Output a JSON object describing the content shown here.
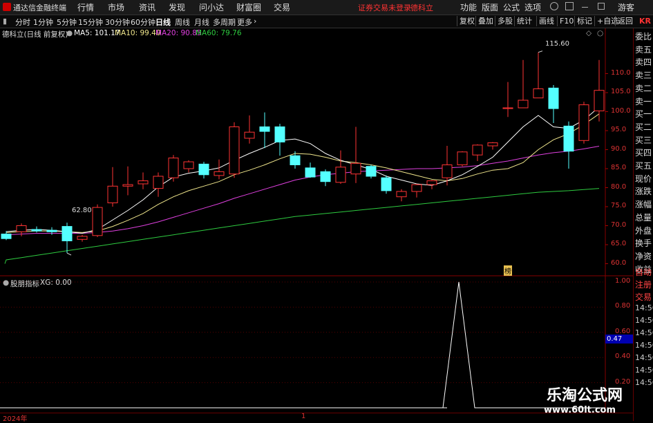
{
  "app": {
    "title": "通达信金融终端"
  },
  "menu": [
    "行情",
    "市场",
    "资讯",
    "发现",
    "问小达",
    "财富圈",
    "交易"
  ],
  "top_notice": {
    "warn": "证券交易未登录",
    "stock": "德科立"
  },
  "top_right": [
    "功能",
    "版面",
    "公式",
    "选项",
    "游客"
  ],
  "periods": [
    "分时",
    "1分钟",
    "5分钟",
    "15分钟",
    "30分钟",
    "60分钟",
    "日线",
    "周线",
    "月线",
    "多周期",
    "更多"
  ],
  "active_period": "日线",
  "tools": [
    "复权",
    "叠加",
    "多股",
    "统计",
    "画线",
    "F10",
    "标记",
    "+自选",
    "返回"
  ],
  "kr_label": "KR",
  "main_info": {
    "name": "德科立(日线 前复权)",
    "ma5": "MA5: 101.17",
    "ma10": "MA10: 99.40",
    "ma20": "MA20: 90.85",
    "ma60": "MA60: 79.76"
  },
  "colors": {
    "ma5": "#ffffff",
    "ma10": "#f0e68c",
    "ma20": "#e040e0",
    "ma60": "#2ecc40",
    "up": "#ff3333",
    "down": "#54ffff"
  },
  "annotations": {
    "high": "115.60",
    "low": "62.80",
    "mark": "榜"
  },
  "price_axis": [
    "110.0",
    "105.0",
    "100.0",
    "95.0",
    "90.0",
    "85.0",
    "80.0",
    "75.0",
    "70.0",
    "65.0",
    "60.0"
  ],
  "right_quote_labels": [
    "委比",
    "卖五",
    "卖四",
    "卖三",
    "卖二",
    "卖一",
    "买一",
    "买二",
    "买三",
    "买四",
    "买五",
    "现价",
    "涨跌",
    "涨幅",
    "总量",
    "外盘",
    "换手",
    "净资",
    "收益"
  ],
  "indicator": {
    "name": "股朋指标",
    "value": "XG: 0.00",
    "axis": [
      "1.00",
      "0.80",
      "0.60",
      "0.40",
      "0.20"
    ],
    "cursor_value": "0.47"
  },
  "right_lower_labels": [
    "自动",
    "注册",
    "交易",
    "14:56",
    "14:56",
    "14:56",
    "14:56",
    "14:56",
    "14:56",
    "14:56"
  ],
  "bottom_axis": {
    "year": "2024年",
    "mark": "1"
  },
  "watermark": {
    "line1": "乐淘公式网",
    "line2": "www.60lt.com"
  },
  "chart_data": {
    "type": "candlestick",
    "ylim": [
      57,
      119
    ],
    "candles": [
      {
        "o": 67.8,
        "h": 68.6,
        "l": 66.2,
        "c": 66.6
      },
      {
        "o": 68.4,
        "h": 70.6,
        "l": 67.2,
        "c": 70.0
      },
      {
        "o": 69.0,
        "h": 69.8,
        "l": 68.2,
        "c": 68.6
      },
      {
        "o": 68.8,
        "h": 69.6,
        "l": 67.6,
        "c": 68.4
      },
      {
        "o": 69.8,
        "h": 70.8,
        "l": 62.8,
        "c": 66.0
      },
      {
        "o": 66.4,
        "h": 67.6,
        "l": 65.8,
        "c": 67.2
      },
      {
        "o": 67.4,
        "h": 75.6,
        "l": 67.0,
        "c": 74.8
      },
      {
        "o": 76.0,
        "h": 85.4,
        "l": 75.0,
        "c": 80.4
      },
      {
        "o": 80.4,
        "h": 85.6,
        "l": 78.0,
        "c": 80.8
      },
      {
        "o": 81.0,
        "h": 84.0,
        "l": 79.6,
        "c": 81.8
      },
      {
        "o": 79.8,
        "h": 84.0,
        "l": 77.6,
        "c": 83.0
      },
      {
        "o": 82.6,
        "h": 88.6,
        "l": 81.6,
        "c": 87.8
      },
      {
        "o": 85.0,
        "h": 87.2,
        "l": 84.0,
        "c": 86.8
      },
      {
        "o": 86.2,
        "h": 86.8,
        "l": 82.4,
        "c": 83.4
      },
      {
        "o": 83.2,
        "h": 87.4,
        "l": 82.2,
        "c": 84.2
      },
      {
        "o": 83.6,
        "h": 97.2,
        "l": 82.6,
        "c": 96.0
      },
      {
        "o": 93.0,
        "h": 99.0,
        "l": 91.6,
        "c": 94.6
      },
      {
        "o": 96.0,
        "h": 99.8,
        "l": 90.4,
        "c": 94.8
      },
      {
        "o": 96.0,
        "h": 96.8,
        "l": 88.4,
        "c": 92.0
      },
      {
        "o": 88.4,
        "h": 89.6,
        "l": 85.0,
        "c": 86.0
      },
      {
        "o": 85.2,
        "h": 86.6,
        "l": 82.6,
        "c": 82.8
      },
      {
        "o": 84.2,
        "h": 84.8,
        "l": 80.4,
        "c": 81.6
      },
      {
        "o": 81.4,
        "h": 89.8,
        "l": 81.0,
        "c": 85.4
      },
      {
        "o": 83.6,
        "h": 96.0,
        "l": 81.2,
        "c": 86.4
      },
      {
        "o": 85.6,
        "h": 86.0,
        "l": 82.4,
        "c": 83.0
      },
      {
        "o": 82.6,
        "h": 83.2,
        "l": 78.4,
        "c": 79.2
      },
      {
        "o": 77.6,
        "h": 79.6,
        "l": 76.4,
        "c": 79.0
      },
      {
        "o": 79.0,
        "h": 81.0,
        "l": 77.4,
        "c": 80.8
      },
      {
        "o": 80.8,
        "h": 82.0,
        "l": 79.6,
        "c": 81.8
      },
      {
        "o": 82.6,
        "h": 91.0,
        "l": 80.6,
        "c": 86.0
      },
      {
        "o": 86.0,
        "h": 89.6,
        "l": 85.6,
        "c": 89.4
      },
      {
        "o": 88.6,
        "h": 91.4,
        "l": 87.0,
        "c": 91.2
      },
      {
        "o": 91.0,
        "h": 92.0,
        "l": 90.0,
        "c": 91.8
      },
      {
        "o": 100.8,
        "h": 107.8,
        "l": 98.6,
        "c": 101.0
      },
      {
        "o": 101.0,
        "h": 113.6,
        "l": 101.0,
        "c": 103.0
      },
      {
        "o": 103.6,
        "h": 115.6,
        "l": 103.6,
        "c": 106.0
      },
      {
        "o": 106.2,
        "h": 107.0,
        "l": 97.0,
        "c": 100.8
      },
      {
        "o": 96.2,
        "h": 97.4,
        "l": 85.0,
        "c": 89.6
      },
      {
        "o": 92.4,
        "h": 102.6,
        "l": 91.6,
        "c": 101.8
      },
      {
        "o": 100.2,
        "h": 113.6,
        "l": 97.4,
        "c": 105.6
      }
    ],
    "ma5": [
      68.4,
      68.8,
      69.0,
      68.8,
      68.4,
      68.0,
      69.0,
      71.5,
      74.0,
      76.8,
      80.2,
      82.8,
      83.8,
      84.4,
      85.2,
      87.2,
      89.0,
      90.6,
      92.4,
      92.8,
      91.6,
      89.0,
      87.2,
      86.0,
      84.8,
      83.0,
      82.0,
      81.0,
      80.6,
      81.8,
      83.4,
      85.6,
      88.0,
      92.0,
      96.0,
      99.0,
      96.0,
      95.6,
      97.8,
      101.2
    ],
    "ma10": [
      68.2,
      68.4,
      68.6,
      68.6,
      68.4,
      68.2,
      68.6,
      69.8,
      71.4,
      73.2,
      75.6,
      77.6,
      79.2,
      80.4,
      81.6,
      83.4,
      84.6,
      86.0,
      87.6,
      89.0,
      88.8,
      88.0,
      87.0,
      86.6,
      86.0,
      85.2,
      84.2,
      83.2,
      82.2,
      81.8,
      82.4,
      83.6,
      84.6,
      85.0,
      86.6,
      90.0,
      92.6,
      94.2,
      96.6,
      99.4
    ],
    "ma20": [
      67.6,
      67.8,
      68.0,
      68.0,
      68.0,
      68.0,
      68.2,
      68.6,
      69.2,
      70.0,
      71.0,
      72.2,
      73.4,
      74.6,
      75.8,
      77.2,
      78.4,
      79.6,
      80.8,
      82.0,
      82.8,
      83.4,
      83.8,
      84.2,
      84.4,
      84.6,
      84.8,
      85.0,
      85.0,
      85.2,
      85.4,
      85.8,
      86.4,
      87.0,
      87.8,
      88.6,
      89.2,
      89.6,
      90.2,
      90.9
    ],
    "ma60": [
      61.0,
      61.6,
      62.2,
      62.8,
      63.4,
      64.0,
      64.6,
      65.2,
      65.8,
      66.4,
      67.0,
      67.6,
      68.2,
      68.8,
      69.4,
      70.0,
      70.6,
      71.2,
      71.8,
      72.4,
      72.8,
      73.2,
      73.6,
      74.0,
      74.4,
      74.8,
      75.2,
      75.6,
      76.0,
      76.4,
      76.8,
      77.2,
      77.6,
      78.0,
      78.4,
      78.8,
      79.0,
      79.2,
      79.5,
      79.8
    ],
    "indicator_xg": [
      0,
      0,
      0,
      0,
      0,
      0,
      0,
      0,
      0,
      0,
      0,
      0,
      0,
      0,
      0,
      0,
      0,
      0,
      0,
      0,
      0,
      0,
      0,
      0,
      0,
      0,
      0,
      0,
      0,
      0,
      1,
      0,
      0,
      0,
      0,
      0,
      0,
      0,
      0,
      0
    ]
  }
}
